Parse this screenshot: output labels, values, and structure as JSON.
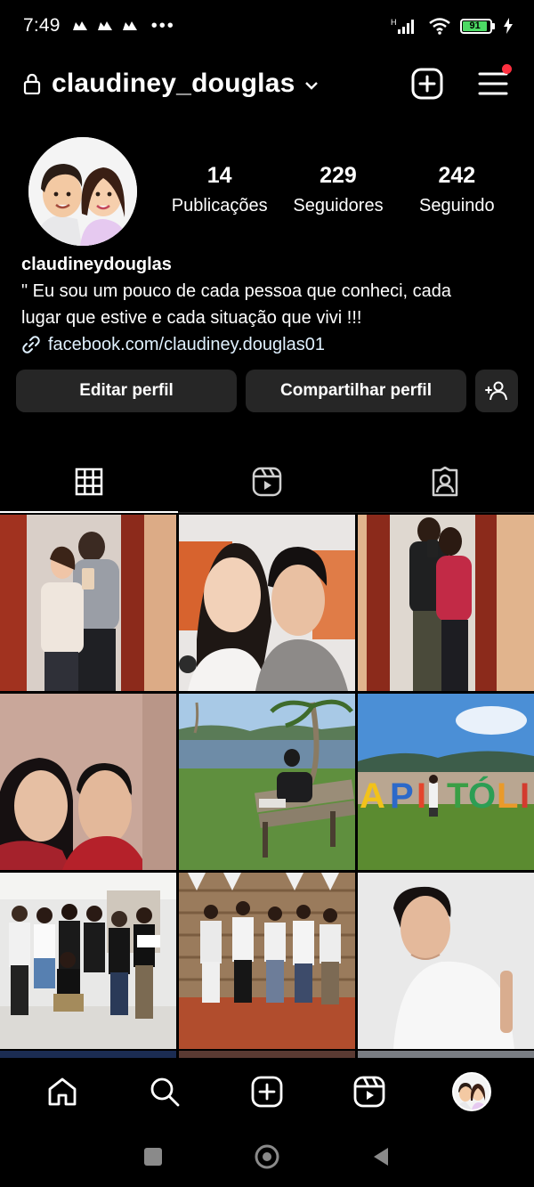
{
  "status": {
    "time": "7:49",
    "more": "•••",
    "network": "H",
    "battery": "91"
  },
  "header": {
    "username": "claudiney_douglas"
  },
  "profile": {
    "posts_count": "14",
    "posts_label": "Publicações",
    "followers_count": "229",
    "followers_label": "Seguidores",
    "following_count": "242",
    "following_label": "Seguindo",
    "name": "claudineydouglas",
    "bio_line1": "\" Eu sou um pouco de cada pessoa que conheci, cada",
    "bio_line2": "lugar que estive e cada situação que vivi !!!",
    "link": "facebook.com/claudiney.douglas01"
  },
  "actions": {
    "edit": "Editar perfil",
    "share": "Compartilhar perfil"
  },
  "colors": {
    "background": "#000000",
    "button": "#262626",
    "notification": "#ff3040",
    "battery": "#4cd964"
  },
  "icons": {
    "tabs": [
      "grid-icon",
      "reels-icon",
      "tagged-icon"
    ],
    "nav": [
      "home-icon",
      "search-icon",
      "create-icon",
      "reels-icon",
      "profile-avatar"
    ]
  }
}
